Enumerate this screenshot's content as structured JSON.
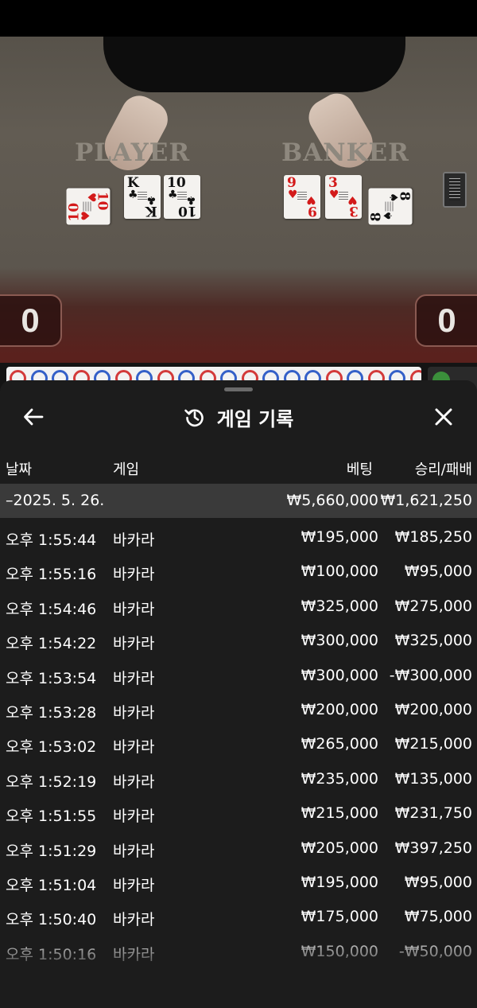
{
  "table": {
    "player_label": "PLAYER",
    "banker_label": "BANKER",
    "player_score": "0",
    "banker_score": "0",
    "player_cards": [
      {
        "rank": "10",
        "suit": "♥",
        "color": "red"
      },
      {
        "rank": "K",
        "suit": "♣",
        "color": "black"
      },
      {
        "rank": "10",
        "suit": "♣",
        "color": "black"
      }
    ],
    "banker_cards": [
      {
        "rank": "9",
        "suit": "♥",
        "color": "red"
      },
      {
        "rank": "3",
        "suit": "♥",
        "color": "red"
      },
      {
        "rank": "8",
        "suit": "♠",
        "color": "black"
      }
    ]
  },
  "road": {
    "beads": [
      "r",
      "b",
      "b",
      "r",
      "b",
      "r",
      "b",
      "r",
      "b",
      "r",
      "b",
      "r",
      "b",
      "b",
      "b",
      "r",
      "b",
      "r",
      "b",
      "r"
    ]
  },
  "panel": {
    "title": "게임 기록",
    "columns": {
      "date": "날짜",
      "game": "게임",
      "bet": "베팅",
      "win_loss": "승리/패배"
    },
    "summary": {
      "date": "–2025. 5. 26.",
      "bet": "₩5,660,000",
      "win_loss": "₩1,621,250"
    },
    "rows": [
      {
        "time": "오후 1:55:44",
        "game": "바카라",
        "bet": "₩195,000",
        "win_loss": "₩185,250"
      },
      {
        "time": "오후 1:55:16",
        "game": "바카라",
        "bet": "₩100,000",
        "win_loss": "₩95,000"
      },
      {
        "time": "오후 1:54:46",
        "game": "바카라",
        "bet": "₩325,000",
        "win_loss": "₩275,000"
      },
      {
        "time": "오후 1:54:22",
        "game": "바카라",
        "bet": "₩300,000",
        "win_loss": "₩325,000"
      },
      {
        "time": "오후 1:53:54",
        "game": "바카라",
        "bet": "₩300,000",
        "win_loss": "-₩300,000"
      },
      {
        "time": "오후 1:53:28",
        "game": "바카라",
        "bet": "₩200,000",
        "win_loss": "₩200,000"
      },
      {
        "time": "오후 1:53:02",
        "game": "바카라",
        "bet": "₩265,000",
        "win_loss": "₩215,000"
      },
      {
        "time": "오후 1:52:19",
        "game": "바카라",
        "bet": "₩235,000",
        "win_loss": "₩135,000"
      },
      {
        "time": "오후 1:51:55",
        "game": "바카라",
        "bet": "₩215,000",
        "win_loss": "₩231,750"
      },
      {
        "time": "오후 1:51:29",
        "game": "바카라",
        "bet": "₩205,000",
        "win_loss": "₩397,250"
      },
      {
        "time": "오후 1:51:04",
        "game": "바카라",
        "bet": "₩195,000",
        "win_loss": "₩95,000"
      },
      {
        "time": "오후 1:50:40",
        "game": "바카라",
        "bet": "₩175,000",
        "win_loss": "₩75,000"
      },
      {
        "time": "오후 1:50:16",
        "game": "바카라",
        "bet": "₩150,000",
        "win_loss": "-₩50,000"
      }
    ]
  },
  "icons": {
    "back": "arrow-left-icon",
    "history": "history-icon",
    "close": "close-icon"
  },
  "colors": {
    "panel_bg": "#1c1c1c",
    "summary_bg": "#3a3a3a",
    "bead_player": "#3460c8",
    "bead_banker": "#d33a3a"
  }
}
